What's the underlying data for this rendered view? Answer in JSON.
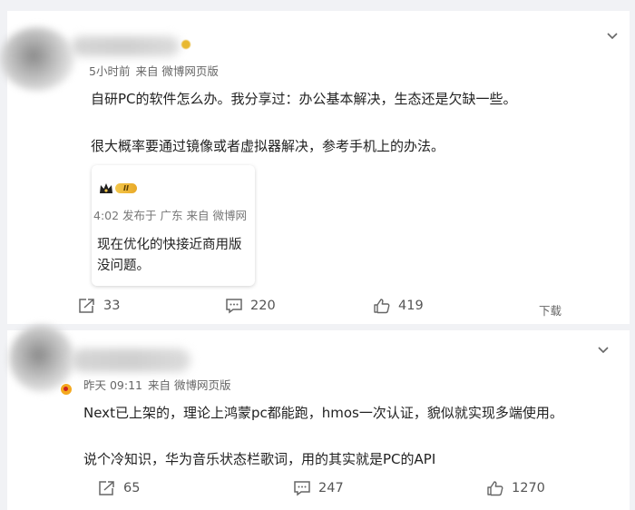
{
  "comments": [
    {
      "time": "5小时前",
      "source": "来自 微博网页版",
      "lines": [
        "自研PC的软件怎么办。我分享过：办公基本解决，生态还是欠缺一些。",
        "很大概率要通过镜像或者虚拟器解决，参考手机上的办法。"
      ],
      "quote": {
        "badge": "II",
        "meta": "4:02 发布于 广东 来自 微博网",
        "lines": [
          "现在优化的快接近商用版",
          "没问题。"
        ]
      },
      "reposts": "33",
      "comments_count": "220",
      "likes": "419",
      "download": "下载"
    },
    {
      "time": "昨天 09:11",
      "source": "来自 微博网页版",
      "lines": [
        "Next已上架的，理论上鸿蒙pc都能跑，hmos一次认证，貌似就实现多端使用。",
        "说个冷知识，华为音乐状态栏歌词，用的其实就是PC的API"
      ],
      "reposts": "65",
      "comments_count": "247",
      "likes": "1270"
    }
  ],
  "icons": {
    "expand": "chevron-down-icon",
    "repost": "repost-icon",
    "comment": "comment-icon",
    "like": "thumbs-up-icon"
  },
  "colors": {
    "page_bg": "#f1f2f5",
    "card_bg": "#ffffff",
    "badge_gold": "#f3c74b"
  }
}
